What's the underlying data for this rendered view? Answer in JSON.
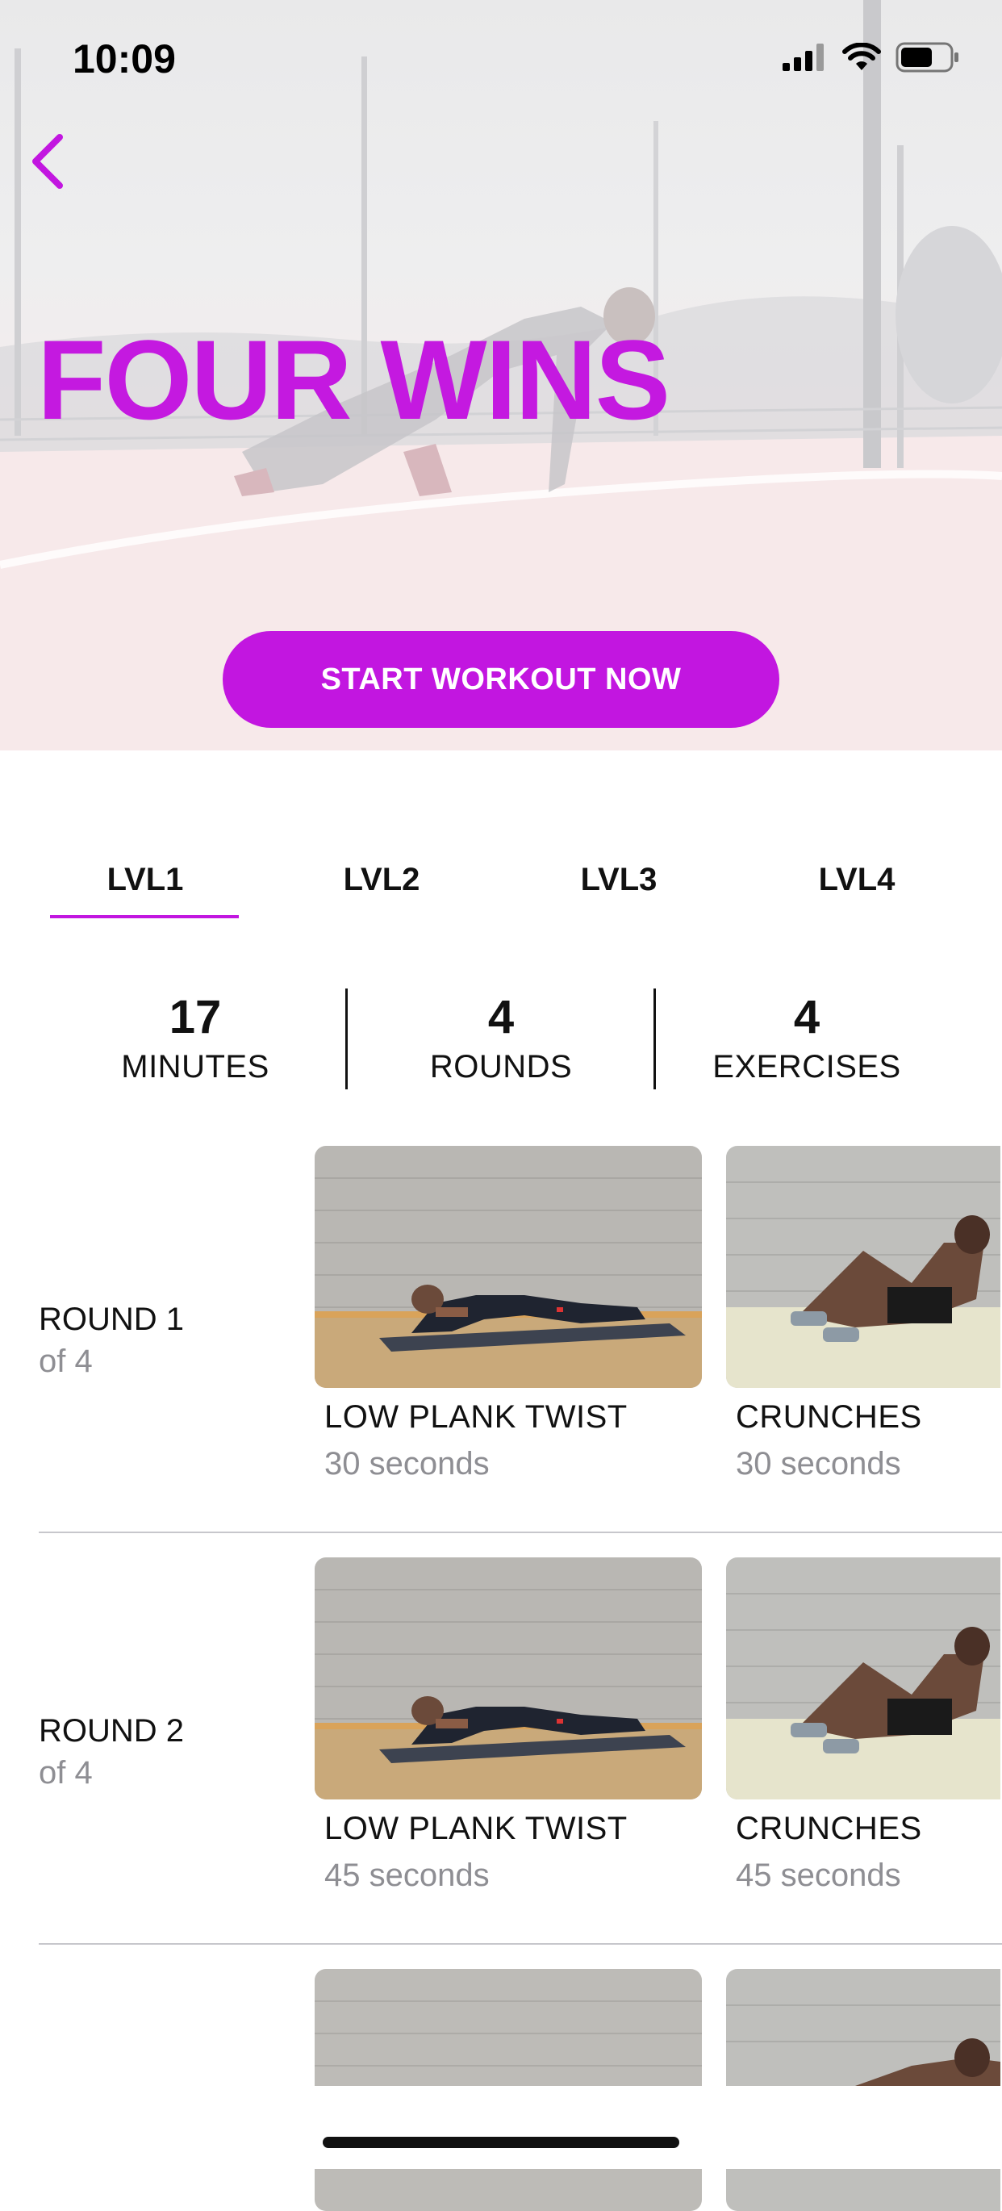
{
  "status_bar": {
    "time": "10:09"
  },
  "hero": {
    "title": "FOUR WINS",
    "start_button": "START WORKOUT NOW"
  },
  "tabs": [
    {
      "label": "LVL1",
      "selected": true
    },
    {
      "label": "LVL2",
      "selected": false
    },
    {
      "label": "LVL3",
      "selected": false
    },
    {
      "label": "LVL4",
      "selected": false
    }
  ],
  "stats": [
    {
      "value": "17",
      "label": "MINUTES"
    },
    {
      "value": "4",
      "label": "ROUNDS"
    },
    {
      "value": "4",
      "label": "EXERCISES"
    }
  ],
  "rounds": [
    {
      "title": "ROUND 1",
      "subtitle": "of 4",
      "exercises": [
        {
          "name": "LOW PLANK TWIST",
          "duration": "30 seconds"
        },
        {
          "name": "CRUNCHES",
          "duration": "30 seconds"
        }
      ]
    },
    {
      "title": "ROUND 2",
      "subtitle": "of 4",
      "exercises": [
        {
          "name": "LOW PLANK TWIST",
          "duration": "45 seconds"
        },
        {
          "name": "CRUNCHES",
          "duration": "45 seconds"
        }
      ]
    }
  ],
  "colors": {
    "accent": "#c216e0",
    "muted_text": "#8e8e93"
  },
  "icons": {
    "back": "chevron-left-icon",
    "signal": "cellular-signal-icon",
    "wifi": "wifi-icon",
    "battery": "battery-icon"
  }
}
